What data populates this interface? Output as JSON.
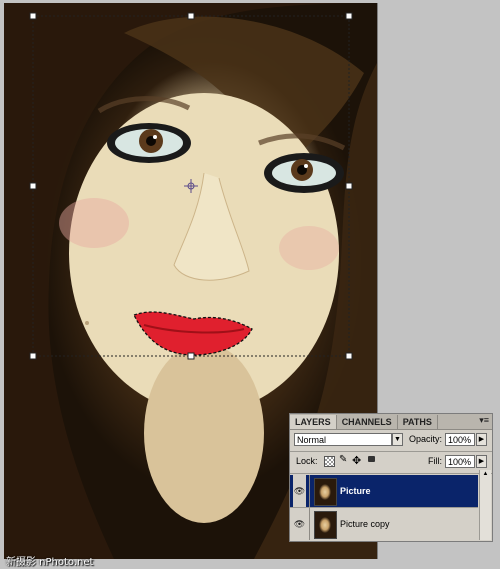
{
  "layers_panel": {
    "tabs": [
      "LAYERS",
      "CHANNELS",
      "PATHS"
    ],
    "active_tab": "LAYERS",
    "menu_glyph": "▾≡",
    "blend_mode": "Normal",
    "opacity_label": "Opacity:",
    "opacity_value": "100%",
    "lock_label": "Lock:",
    "fill_label": "Fill:",
    "fill_value": "100%",
    "layers": [
      {
        "name": "Picture",
        "selected": true,
        "visible": true
      },
      {
        "name": "Picture copy",
        "selected": false,
        "visible": true
      }
    ]
  },
  "watermark": "新摄影 nPhoto.net",
  "colors": {
    "selected_layer": "#0a246a",
    "panel_bg": "#d4d0c8",
    "canvas_bg": "#c3c3c3",
    "lip_color": "#e0202e"
  },
  "icons": {
    "lock_transparency": "checkerboard-icon",
    "lock_paint": "brush-icon",
    "lock_position": "move-icon",
    "lock_all": "padlock-icon",
    "visibility": "eye-icon",
    "dropdown": "triangle-down-icon",
    "stepper": "triangle-right-icon"
  }
}
